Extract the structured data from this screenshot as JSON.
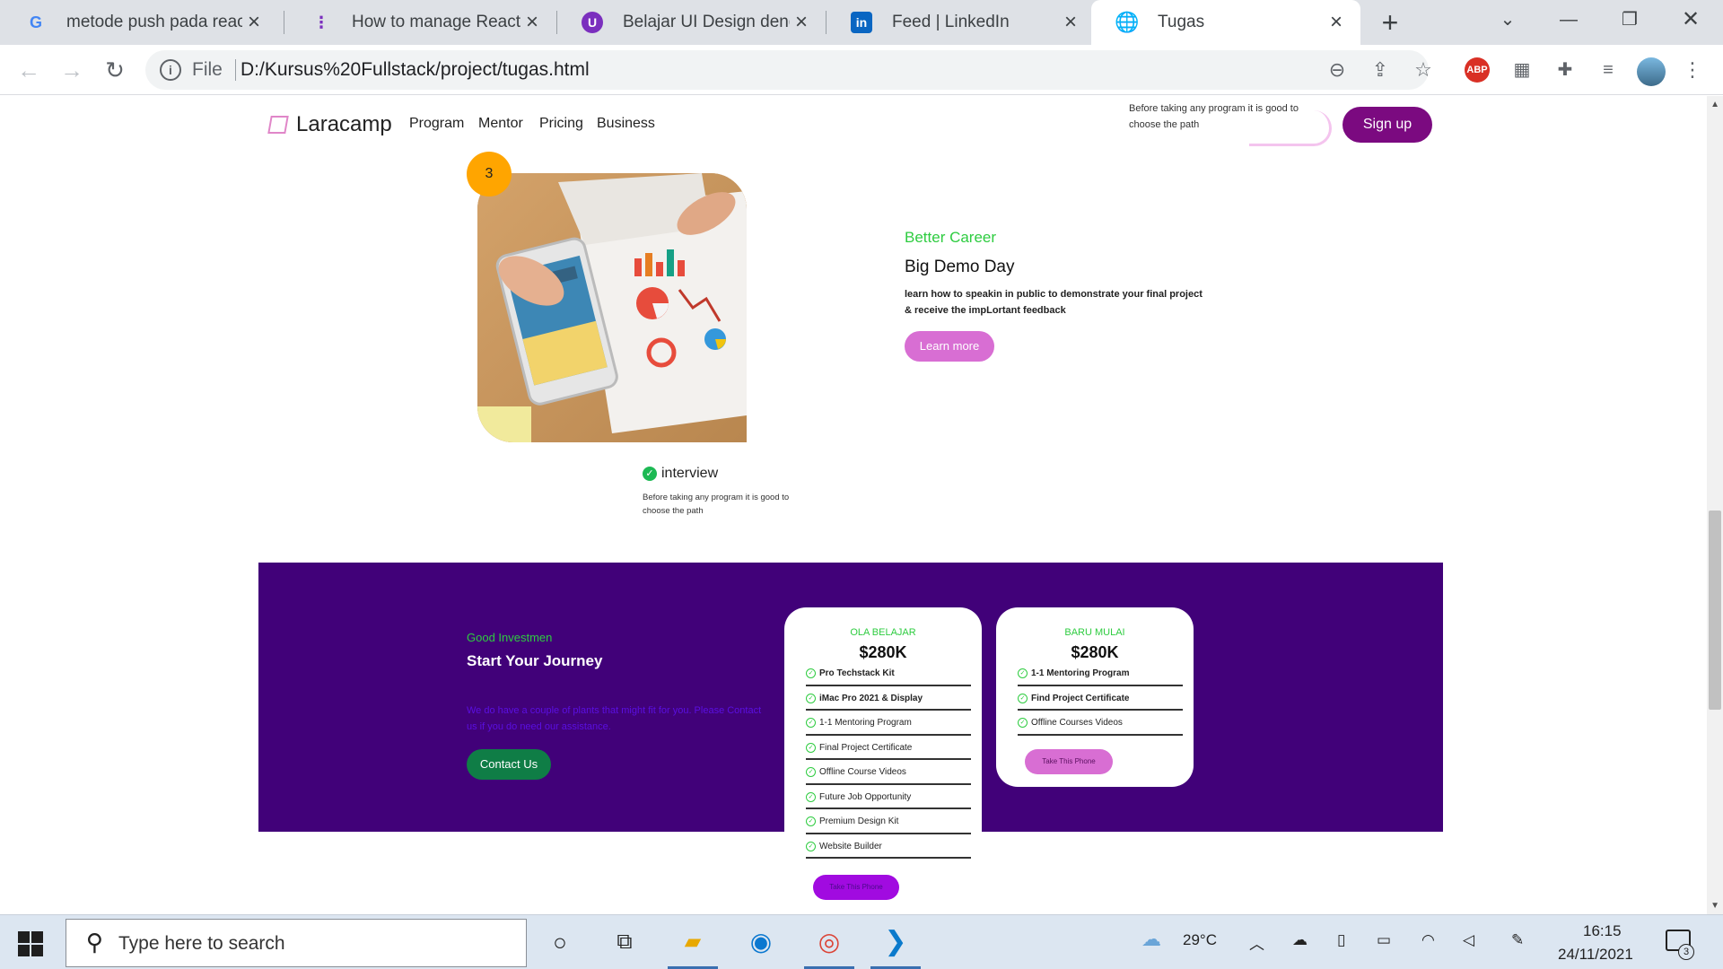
{
  "browser": {
    "tabs": [
      {
        "title": "metode push pada react j",
        "icon": "google-icon",
        "active": false
      },
      {
        "title": "How to manage React Sta",
        "icon": "dots-icon",
        "active": false
      },
      {
        "title": "Belajar UI Design dengan",
        "icon": "u-icon",
        "active": false
      },
      {
        "title": "Feed | LinkedIn",
        "icon": "linkedin-icon",
        "active": false
      },
      {
        "title": "Tugas",
        "icon": "globe-icon",
        "active": true
      }
    ],
    "file_label": "File",
    "url": "D:/Kursus%20Fullstack/project/tugas.html",
    "abp_label": "ABP"
  },
  "site": {
    "brand": "Laracamp",
    "nav": [
      "Program",
      "Mentor",
      "Pricing",
      "Business"
    ],
    "header_hint": "Before taking any program it is good to choose the path",
    "signup_label": "Sign up"
  },
  "feature": {
    "step": "3",
    "kicker": "Better Career",
    "title": "Big Demo Day",
    "description": "learn how to speakin in public to demonstrate your final project & receive the impLortant feedback",
    "learn_more": "Learn more",
    "image_caption": "interview",
    "image_caption_desc": "Before taking any program it is good to choose the path"
  },
  "pricing": {
    "kicker": "Good Investmen",
    "title": "Start Your Journey",
    "description": "We do have a couple of plants that might fit for you. Please Contact us if you do need our assistance.",
    "contact_label": "Contact Us",
    "plans": [
      {
        "name": "OLA BELAJAR",
        "price": "$280K",
        "features": [
          {
            "text": "Pro Techstack Kit",
            "bold": true
          },
          {
            "text": "iMac Pro 2021 & Display",
            "bold": true
          },
          {
            "text": "1-1 Mentoring Program",
            "bold": false
          },
          {
            "text": "Final Project Certificate",
            "bold": false
          },
          {
            "text": "Offline Course Videos",
            "bold": false
          },
          {
            "text": "Future Job Opportunity",
            "bold": false
          },
          {
            "text": "Premium Design Kit",
            "bold": false
          },
          {
            "text": "Website Builder",
            "bold": false
          }
        ],
        "button": "Take This Phone"
      },
      {
        "name": "BARU MULAI",
        "price": "$280K",
        "features": [
          {
            "text": "1-1 Mentoring Program",
            "bold": true
          },
          {
            "text": "Find Project Certificate",
            "bold": true
          },
          {
            "text": "Offline Courses Videos",
            "bold": false
          }
        ],
        "button": "Take This Phone"
      }
    ]
  },
  "taskbar": {
    "search_placeholder": "Type here to search",
    "temperature": "29°C",
    "time": "16:15",
    "date": "24/11/2021",
    "notifications": "3"
  },
  "colors": {
    "brand_purple": "#7b0a80",
    "band_purple": "#410179",
    "accent_green": "#2ecc40",
    "pink": "#d86ed3",
    "badge_orange": "#ffa500",
    "contact_green": "#0f7d46"
  }
}
